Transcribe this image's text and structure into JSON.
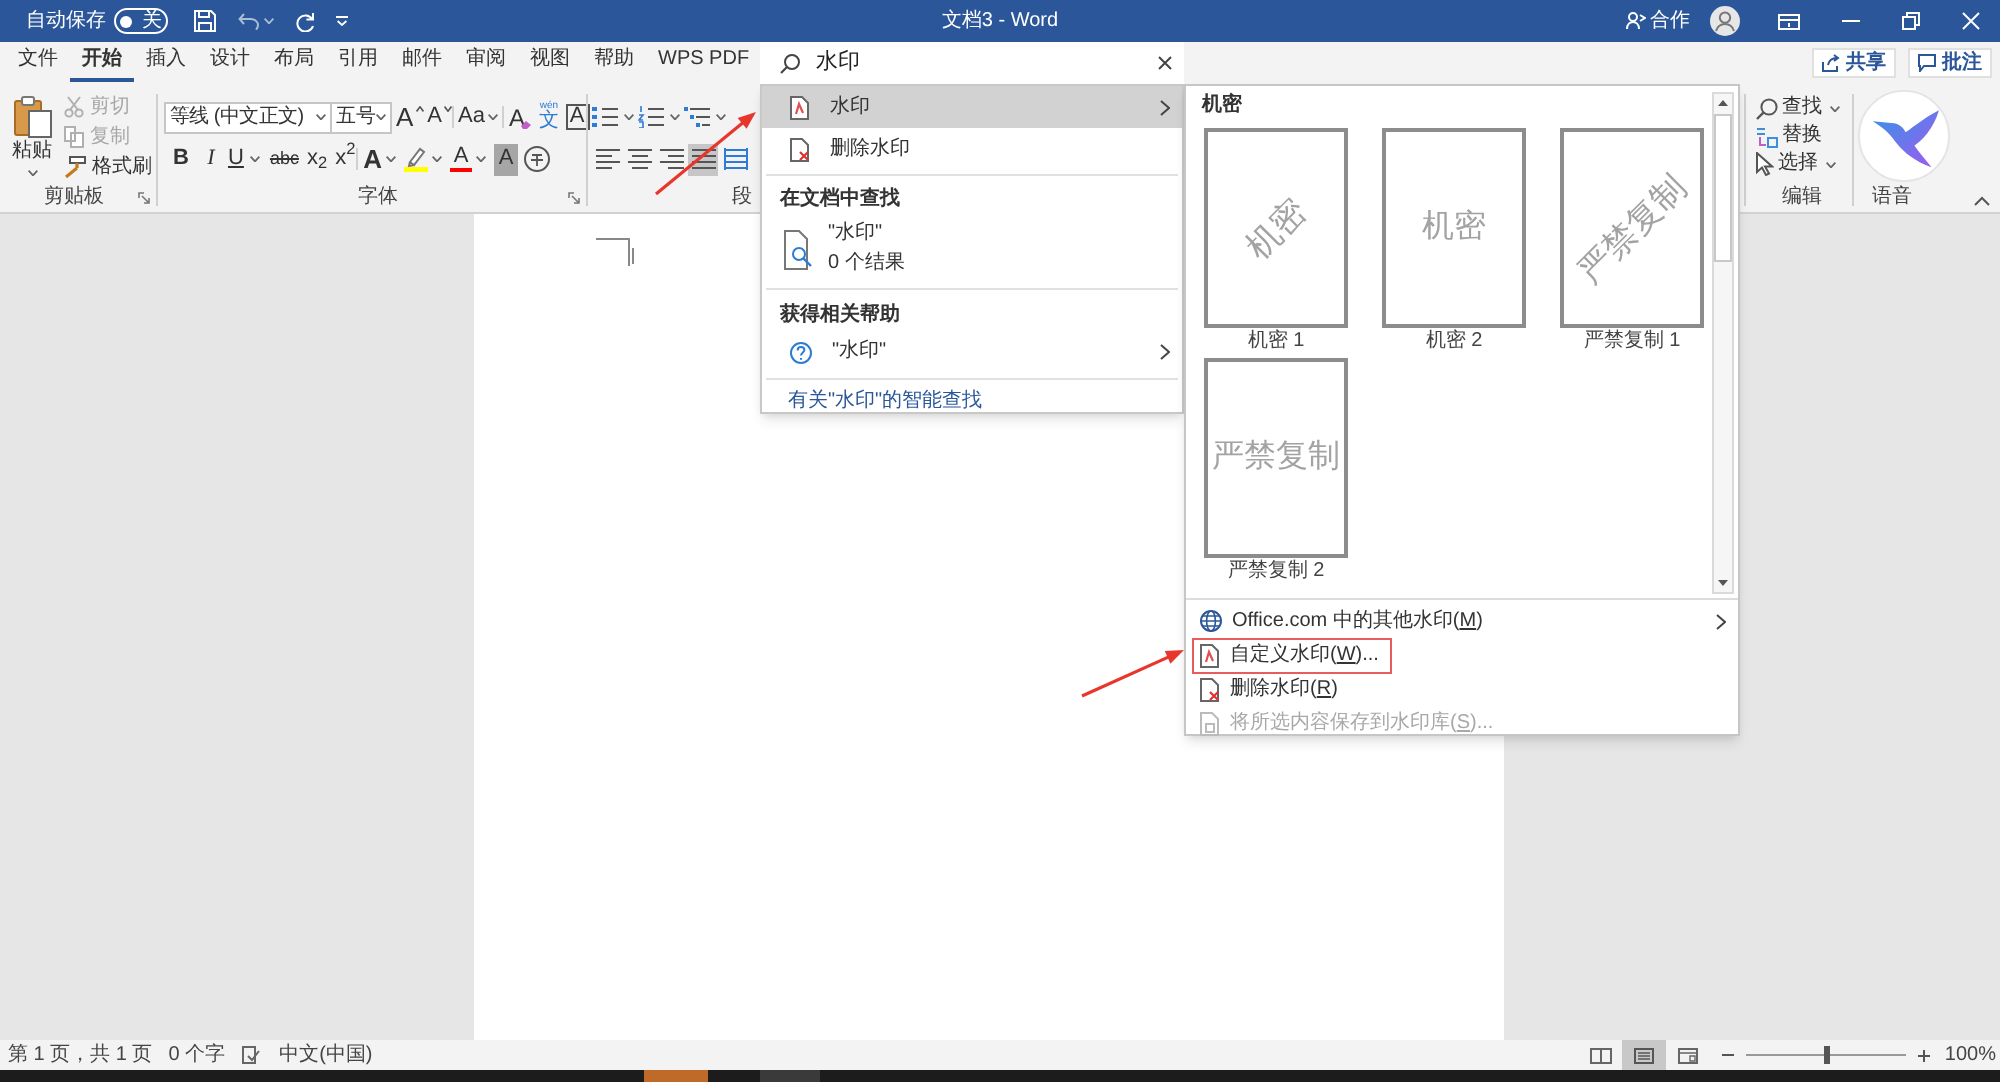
{
  "title_bar": {
    "autosave_label": "自动保存",
    "autosave_toggle": {
      "on": false,
      "label": "关"
    },
    "title": "文档3 - Word",
    "coauthor_label": "合作"
  },
  "tabs": [
    {
      "label": "文件",
      "selected": false
    },
    {
      "label": "开始",
      "selected": true
    },
    {
      "label": "插入",
      "selected": false
    },
    {
      "label": "设计",
      "selected": false
    },
    {
      "label": "布局",
      "selected": false
    },
    {
      "label": "引用",
      "selected": false
    },
    {
      "label": "邮件",
      "selected": false
    },
    {
      "label": "审阅",
      "selected": false
    },
    {
      "label": "视图",
      "selected": false
    },
    {
      "label": "帮助",
      "selected": false
    },
    {
      "label": "WPS PDF",
      "selected": false
    }
  ],
  "ribbon_buttons": [
    {
      "kind": "share",
      "label": "共享"
    },
    {
      "kind": "comments",
      "label": "批注"
    }
  ],
  "search": {
    "value": "水印"
  },
  "ribbon": {
    "clipboard": {
      "paste": "粘贴",
      "small_buttons": [
        {
          "kind": "cut",
          "label": "剪切",
          "disabled": true
        },
        {
          "kind": "copy",
          "label": "复制",
          "disabled": true
        },
        {
          "kind": "painter",
          "label": "格式刷",
          "disabled": false
        }
      ],
      "group_label": "剪贴板"
    },
    "font": {
      "font_name": "等线 (中文正文)",
      "font_size": "五号",
      "row_1": [
        {
          "kind": "grow",
          "glyph": "A"
        },
        {
          "kind": "shrink",
          "glyph": "A"
        },
        {
          "kind": "case",
          "glyph": "Aa"
        },
        {
          "kind": "clear",
          "glyph": "A"
        },
        {
          "kind": "phonetic",
          "glyph": "文",
          "ruby": "wén"
        },
        {
          "kind": "border",
          "glyph": "A"
        }
      ],
      "row_2": [
        {
          "kind": "bold",
          "glyph": "B"
        },
        {
          "kind": "italic",
          "glyph": "I"
        },
        {
          "kind": "underline",
          "glyph": "U"
        },
        {
          "kind": "strike",
          "glyph": "abc"
        },
        {
          "kind": "subscript",
          "glyph": "x$_{2}$"
        },
        {
          "kind": "superscript",
          "glyph": "x$^{2}$"
        },
        {
          "kind": "effects",
          "glyph": "A"
        },
        {
          "kind": "highlight"
        },
        {
          "kind": "color",
          "glyph": "A"
        },
        {
          "kind": "shading",
          "glyph": "A"
        },
        {
          "kind": "enclose"
        }
      ],
      "group_label": "字体"
    },
    "paragraph": {
      "alignment": [
        {
          "kind": "left",
          "selected": false
        },
        {
          "kind": "center",
          "selected": false
        },
        {
          "kind": "right",
          "selected": false
        },
        {
          "kind": "justify",
          "selected": true
        },
        {
          "kind": "distributed",
          "selected": false
        }
      ],
      "group_label": "段"
    },
    "editing": {
      "items": [
        {
          "kind": "find",
          "label": "查找",
          "dropdown": true
        },
        {
          "kind": "replace",
          "label": "替换",
          "dropdown": false
        },
        {
          "kind": "select",
          "label": "选择",
          "dropdown": true
        }
      ],
      "group_label": "编辑"
    },
    "voice": {
      "group_label": "语音"
    }
  },
  "search_panel": {
    "actions": [
      {
        "kind": "watermark",
        "label": "水印",
        "selected": true,
        "submenu": true
      },
      {
        "kind": "remove",
        "label": "删除水印",
        "selected": false,
        "submenu": false
      }
    ],
    "find_heading": "在文档中查找",
    "find_result": {
      "query": "\"水印\"",
      "count": "0 个结果"
    },
    "help_heading": "获得相关帮助",
    "help_item": {
      "query": "\"水印\""
    },
    "smart_lookup": "有关\"水印\"的智能查找"
  },
  "watermark_gallery": {
    "category": "机密",
    "items": [
      {
        "label": "机密 1",
        "watermark": "机密",
        "kind": "diagonal"
      },
      {
        "label": "机密 2",
        "watermark": "机密",
        "kind": "horizontal"
      },
      {
        "label": "严禁复制 1",
        "watermark": "严禁复制",
        "kind": "diagonal"
      },
      {
        "label": "严禁复制 2",
        "watermark": "严禁复制",
        "kind": "horizontal"
      }
    ],
    "menu": [
      {
        "kind": "online",
        "before": "Office.com 中的其他水印(",
        "key": "M",
        "after": ")",
        "submenu": true,
        "disabled": false,
        "highlighted": false
      },
      {
        "kind": "custom",
        "before": "自定义水印(",
        "key": "W",
        "after": ")...",
        "submenu": false,
        "disabled": false,
        "highlighted": true
      },
      {
        "kind": "remove",
        "before": "删除水印(",
        "key": "R",
        "after": ")",
        "submenu": false,
        "disabled": false,
        "highlighted": false
      },
      {
        "kind": "save",
        "before": "将所选内容保存到水印库(",
        "key": "S",
        "after": ")...",
        "submenu": false,
        "disabled": true,
        "highlighted": false
      }
    ]
  },
  "status_bar": {
    "page": "第 1 页，共 1 页",
    "words": "0 个字",
    "language": "中文(中国)",
    "views": [
      {
        "kind": "read",
        "selected": false
      },
      {
        "kind": "print",
        "selected": true
      },
      {
        "kind": "web",
        "selected": false
      }
    ],
    "zoom": {
      "level": 0.5,
      "reading": "100%"
    }
  }
}
